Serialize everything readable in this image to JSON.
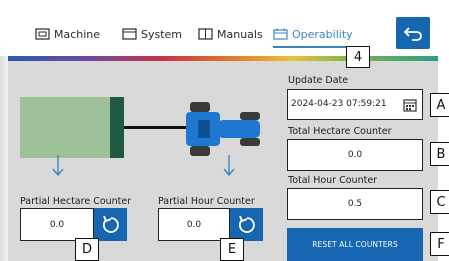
{
  "tabs": [
    {
      "label": "Machine",
      "icon": "machine-icon"
    },
    {
      "label": "System",
      "icon": "system-icon"
    },
    {
      "label": "Manuals",
      "icon": "manuals-icon"
    },
    {
      "label": "Operability",
      "icon": "operability-icon",
      "active": true
    }
  ],
  "header": {
    "back_icon": "back-arrow-icon"
  },
  "update_date": {
    "label": "Update Date",
    "value": "2024-04-23 07:59:21",
    "icon": "calendar-icon"
  },
  "total_hectare": {
    "label": "Total Hectare Counter",
    "value": "0.0"
  },
  "total_hour": {
    "label": "Total Hour Counter",
    "value": "0.5"
  },
  "partial_hectare": {
    "label": "Partial Hectare Counter",
    "value": "0.0",
    "reset_icon": "reset-icon"
  },
  "partial_hour": {
    "label": "Partial Hour Counter",
    "value": "0.0",
    "reset_icon": "reset-icon"
  },
  "reset_all_label": "RESET ALL COUNTERS",
  "callouts": {
    "four": "4",
    "a": "A",
    "b": "B",
    "c": "C",
    "d": "D",
    "e": "E",
    "f": "F"
  },
  "colors": {
    "accent": "#1766b2",
    "active_tab": "#3d86c6",
    "panel": "#d9d9d9",
    "field": "#9fc19a",
    "bar": "#1f5a40"
  }
}
